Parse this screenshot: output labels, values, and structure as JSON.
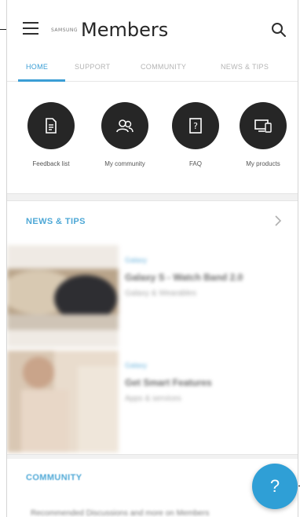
{
  "header": {
    "brand_prefix": "SAMSUNG",
    "brand_name": "Members",
    "menu_icon": "hamburger-menu-icon",
    "search_icon": "search-icon"
  },
  "tabs": [
    {
      "label": "HOME",
      "active": true
    },
    {
      "label": "SUPPORT",
      "active": false
    },
    {
      "label": "COMMUNITY",
      "active": false
    },
    {
      "label": "NEWS & TIPS",
      "active": false
    }
  ],
  "quick_actions": [
    {
      "label": "Feedback list",
      "icon": "document-icon"
    },
    {
      "label": "My community",
      "icon": "people-icon"
    },
    {
      "label": "FAQ",
      "icon": "question-doc-icon"
    },
    {
      "label": "My products",
      "icon": "devices-icon"
    }
  ],
  "news": {
    "title": "NEWS & TIPS",
    "items": [
      {
        "tag": "Galaxy",
        "title": "Galaxy S - Watch Band 2.0",
        "subtitle": "Galaxy & Wearables"
      },
      {
        "tag": "Galaxy",
        "title": "Get Smart Features",
        "subtitle": "Apps & services"
      }
    ]
  },
  "community": {
    "title": "COMMUNITY",
    "preview": "Recommended Discussions and more on Members"
  },
  "help_button": {
    "label": "?",
    "icon": "help-icon"
  },
  "colors": {
    "accent": "#3b9ed5",
    "fab": "#2f9fd6",
    "icon_circle": "#262626"
  }
}
